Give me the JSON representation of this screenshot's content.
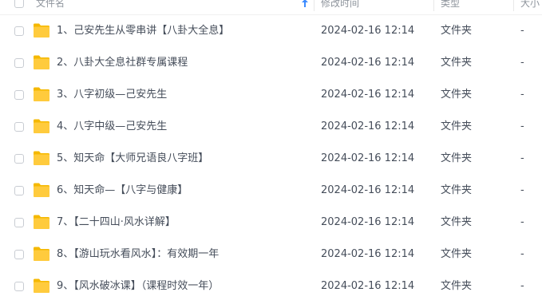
{
  "header": {
    "name_label": "文件名",
    "sort_icon": "arrow-up-icon",
    "time_label": "修改时间",
    "type_label": "类型",
    "size_label": "大小"
  },
  "icons": {
    "folder": "folder-icon",
    "folder_color": "#ffc933"
  },
  "files": [
    {
      "name": "1、己安先生从零串讲【八卦大全息】",
      "time": "2024-02-16 12:14",
      "type": "文件夹",
      "size": "-"
    },
    {
      "name": "2、八卦大全息社群专属课程",
      "time": "2024-02-16 12:14",
      "type": "文件夹",
      "size": "-"
    },
    {
      "name": "3、八字初级—己安先生",
      "time": "2024-02-16 12:14",
      "type": "文件夹",
      "size": "-"
    },
    {
      "name": "4、八字中级—己安先生",
      "time": "2024-02-16 12:14",
      "type": "文件夹",
      "size": "-"
    },
    {
      "name": "5、知天命【大师兄语良八字班】",
      "time": "2024-02-16 12:14",
      "type": "文件夹",
      "size": "-"
    },
    {
      "name": "6、知天命—【八字与健康】",
      "time": "2024-02-16 12:14",
      "type": "文件夹",
      "size": "-"
    },
    {
      "name": "7、【二十四山·风水详解】",
      "time": "2024-02-16 12:14",
      "type": "文件夹",
      "size": "-"
    },
    {
      "name": "8、【游山玩水看风水】：有效期一年",
      "time": "2024-02-16 12:14",
      "type": "文件夹",
      "size": "-"
    },
    {
      "name": "9、【风水破冰课】（课程时效一年）",
      "time": "2024-02-16 12:14",
      "type": "文件夹",
      "size": "-"
    }
  ]
}
